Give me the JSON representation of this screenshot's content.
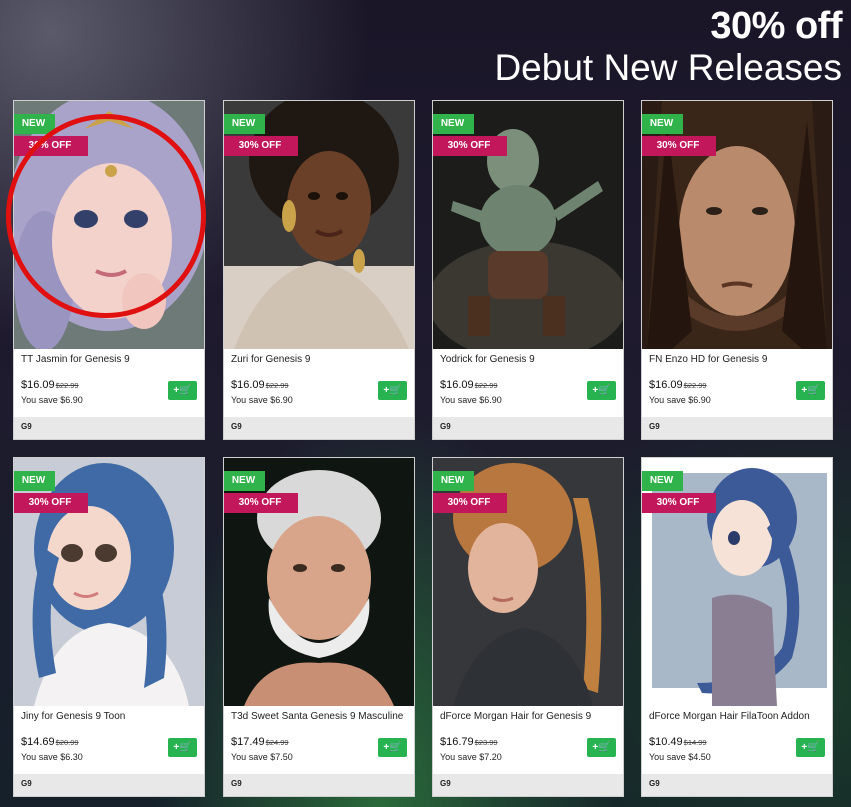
{
  "headline": {
    "promo": "30% off",
    "subtitle": "Debut New Releases"
  },
  "badges": {
    "new": "NEW",
    "off": "30% OFF"
  },
  "cart_icon_glyph": "+🛒",
  "colors": {
    "new_badge": "#2fb34a",
    "off_badge": "#c2185b",
    "cart_button": "#27b34f",
    "highlight_circle": "#e01010"
  },
  "products": [
    {
      "title": "TT Jasmin for Genesis 9",
      "price": "$16.09",
      "old_price": "$22.99",
      "save": "You save $6.90",
      "tag": "G9"
    },
    {
      "title": "Zuri for Genesis 9",
      "price": "$16.09",
      "old_price": "$22.99",
      "save": "You save $6.90",
      "tag": "G9"
    },
    {
      "title": "Yodrick for Genesis 9",
      "price": "$16.09",
      "old_price": "$22.99",
      "save": "You save $6.90",
      "tag": "G9"
    },
    {
      "title": "FN Enzo HD for Genesis 9",
      "price": "$16.09",
      "old_price": "$22.99",
      "save": "You save $6.90",
      "tag": "G9"
    },
    {
      "title": "Jiny for Genesis 9 Toon",
      "price": "$14.69",
      "old_price": "$20.99",
      "save": "You save $6.30",
      "tag": "G9"
    },
    {
      "title": "T3d Sweet Santa Genesis 9 Masculine",
      "price": "$17.49",
      "old_price": "$24.99",
      "save": "You save $7.50",
      "tag": "G9"
    },
    {
      "title": "dForce Morgan Hair for Genesis 9",
      "price": "$16.79",
      "old_price": "$23.99",
      "save": "You save $7.20",
      "tag": "G9"
    },
    {
      "title": "dForce Morgan Hair FilaToon Addon",
      "price": "$10.49",
      "old_price": "$14.99",
      "save": "You save $4.50",
      "tag": "G9"
    }
  ]
}
